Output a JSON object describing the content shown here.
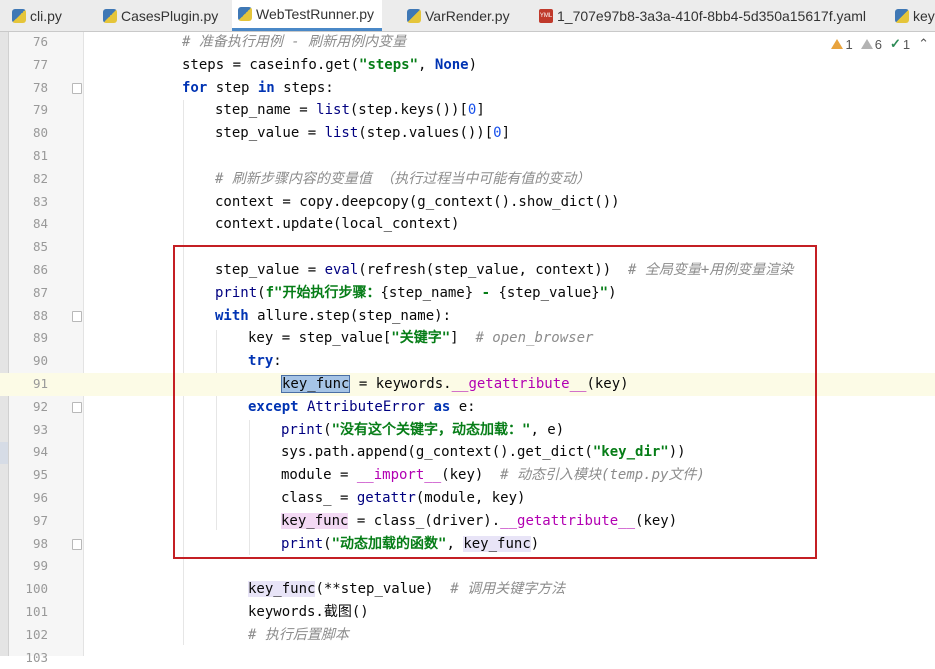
{
  "tabs": [
    {
      "label": "cli.py",
      "icon": "python-file-icon",
      "active": false
    },
    {
      "label": "CasesPlugin.py",
      "icon": "python-file-icon",
      "active": false
    },
    {
      "label": "WebTestRunner.py",
      "icon": "python-file-icon",
      "active": true
    },
    {
      "label": "VarRender.py",
      "icon": "python-file-icon",
      "active": false
    },
    {
      "label": "1_707e97b8-3a3a-410f-8bb4-5d350a15617f.yaml",
      "icon": "yaml-file-icon",
      "active": false
    },
    {
      "label": "key",
      "icon": "python-file-icon",
      "active": false
    }
  ],
  "inspections": {
    "warnings": "1",
    "weak_warnings": "6",
    "typos": "1"
  },
  "line_numbers": [
    "76",
    "77",
    "78",
    "79",
    "80",
    "81",
    "82",
    "83",
    "84",
    "85",
    "86",
    "87",
    "88",
    "89",
    "90",
    "91",
    "92",
    "93",
    "94",
    "95",
    "96",
    "97",
    "98",
    "99",
    "100",
    "101",
    "102",
    "103"
  ],
  "code": {
    "l76_comment": "# 准备执行用例 - 刷新用例内变量",
    "l77_a": "steps = caseinfo.get(",
    "l77_str": "\"steps\"",
    "l77_b": ", ",
    "l77_none": "None",
    "l77_c": ")",
    "l78_for": "for",
    "l78_a": " step ",
    "l78_in": "in",
    "l78_b": " steps:",
    "l79_a": "step_name = ",
    "l79_list": "list",
    "l79_b": "(step.keys())[",
    "l79_num": "0",
    "l79_c": "]",
    "l80_a": "step_value = ",
    "l80_list": "list",
    "l80_b": "(step.values())[",
    "l80_num": "0",
    "l80_c": "]",
    "l82_comment": "# 刷新步骤内容的变量值 （执行过程当中可能有值的变动）",
    "l83": "context = copy.deepcopy(g_context().show_dict())",
    "l84": "context.update(local_context)",
    "l86_a": "step_value = ",
    "l86_eval": "eval",
    "l86_b": "(refresh(step_value, context))  ",
    "l86_comment": "# 全局变量+用例变量渲染",
    "l87_print": "print",
    "l87_a": "(",
    "l87_str1": "f\"开始执行步骤：",
    "l87_b": "{step_name}",
    "l87_str2": " - ",
    "l87_c": "{step_value}",
    "l87_str3": "\"",
    "l87_d": ")",
    "l88_with": "with",
    "l88_a": " allure.step(step_name):",
    "l89_a": "key = step_value[",
    "l89_str": "\"关键字\"",
    "l89_b": "]  ",
    "l89_comment": "# open_browser",
    "l90_try": "try",
    "l90_a": ":",
    "l91_sel": "key_func",
    "l91_a": " = keywords.",
    "l91_dund": "__getattribute__",
    "l91_b": "(key)",
    "l92_except": "except",
    "l92_a": " AttributeError ",
    "l92_as": "as",
    "l92_b": " e:",
    "l93_print": "print",
    "l93_a": "(",
    "l93_str": "\"没有这个关键字，动态加载：\"",
    "l93_b": ", e)",
    "l94_a": "sys.path.append(g_context().get_dict(",
    "l94_str": "\"key_dir\"",
    "l94_b": "))",
    "l95_a": "module = ",
    "l95_dund": "__import__",
    "l95_b": "(key)  ",
    "l95_comment": "# 动态引入模块(temp.py文件)",
    "l96_a": "class_ = ",
    "l96_getattr": "getattr",
    "l96_b": "(module, key)",
    "l97_hl": "key_func",
    "l97_a": " = class_(driver).",
    "l97_dund": "__getattribute__",
    "l97_b": "(key)",
    "l98_print": "print",
    "l98_a": "(",
    "l98_str": "\"动态加载的函数\"",
    "l98_b": ", ",
    "l98_hl": "key_func",
    "l98_c": ")",
    "l100_hl": "key_func",
    "l100_a": "(**step_value)  ",
    "l100_comment": "# 调用关键字方法",
    "l101": "keywords.截图()",
    "l102_comment": "# 执行后置脚本"
  },
  "colors": {
    "highlight_box": "#c41f24",
    "keyword": "#0033b3",
    "string": "#067d17",
    "comment": "#8c8c8c",
    "selection": "#a6c4e6"
  }
}
